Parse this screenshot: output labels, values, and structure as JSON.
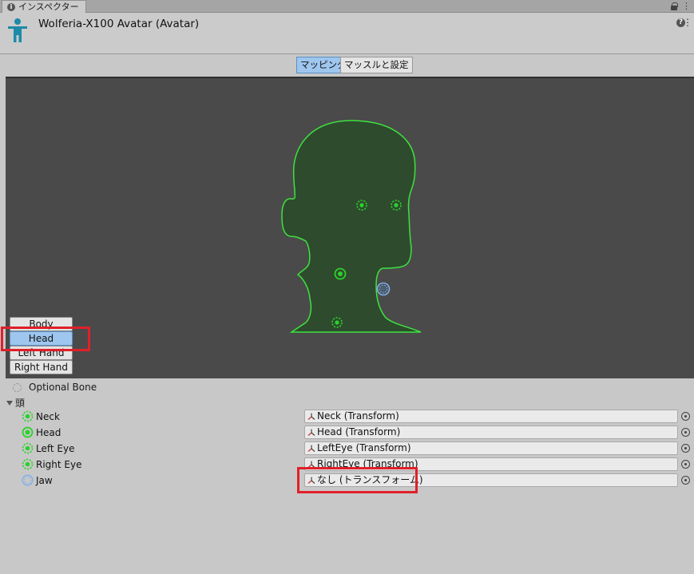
{
  "tab": {
    "label": "インスペクター",
    "info_icon": "info-icon"
  },
  "header": {
    "title": "Wolferia-X100 Avatar (Avatar)",
    "help_icon": "?",
    "menu_icon": "⋮"
  },
  "toolbar": {
    "tabs": [
      {
        "label": "マッピング",
        "active": true
      },
      {
        "label": "マッスルと設定",
        "active": false
      }
    ]
  },
  "body_parts": [
    {
      "label": "Body",
      "active": false
    },
    {
      "label": "Head",
      "active": true
    },
    {
      "label": "Left Hand",
      "active": false
    },
    {
      "label": "Right Hand",
      "active": false
    }
  ],
  "bone_panel": {
    "optional_label": "Optional Bone",
    "section_label": "頭",
    "rows": [
      {
        "label": "Neck",
        "value": "Neck (Transform)",
        "icon": "optional-bone-green"
      },
      {
        "label": "Head",
        "value": "Head (Transform)",
        "icon": "required-bone-green"
      },
      {
        "label": "Left Eye",
        "value": "LeftEye (Transform)",
        "icon": "optional-bone-green"
      },
      {
        "label": "Right Eye",
        "value": "RightEye (Transform)",
        "icon": "optional-bone-green"
      },
      {
        "label": "Jaw",
        "value": "なし (トランスフォーム)",
        "icon": "optional-bone-unassigned"
      }
    ]
  },
  "colors": {
    "accent": "#9ec6ee",
    "highlight": "#e0202a",
    "bone_green": "#2bd12b",
    "bone_unassigned": "#7fb0e8"
  }
}
